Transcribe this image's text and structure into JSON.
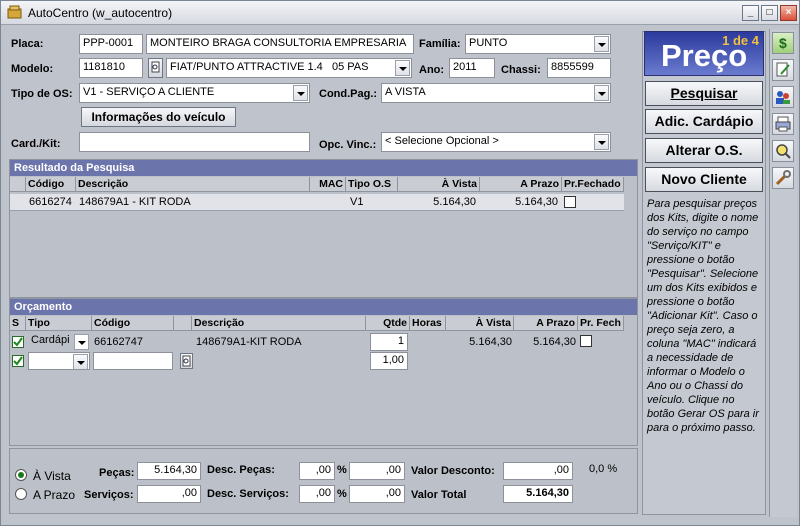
{
  "window": {
    "title": "AutoCentro (w_autocentro)"
  },
  "header": {
    "placa_label": "Placa:",
    "placa_value": "PPP-0001",
    "cliente_nome": "MONTEIRO BRAGA CONSULTORIA EMPRESARIA",
    "familia_label": "Família:",
    "familia_value": "PUNTO",
    "modelo_label": "Modelo:",
    "modelo_code": "1181810",
    "modelo_desc": "FIAT/PUNTO ATTRACTIVE 1.4   05 PAS",
    "ano_label": "Ano:",
    "ano_value": "2011",
    "chassi_label": "Chassi:",
    "chassi_value": "8855599",
    "tipo_os_label": "Tipo de OS:",
    "tipo_os_value": "V1 - SERVIÇO A CLIENTE",
    "cond_pag_label": "Cond.Pag.:",
    "cond_pag_value": "A VISTA",
    "info_veiculo_button": "Informações do veículo",
    "card_kit_label": "Card./Kit:",
    "card_kit_value": "",
    "opc_vinc_label": "Opc. Vinc.:",
    "opc_vinc_value": "< Selecione Opcional >"
  },
  "resultado": {
    "title": "Resultado da Pesquisa",
    "columns": [
      "Código",
      "Descrição",
      "MAC",
      "Tipo O.S",
      "À Vista",
      "A Prazo",
      "Pr.Fechado"
    ],
    "rows": [
      {
        "codigo": "6616274",
        "descricao": "148679A1 - KIT RODA",
        "mac": "",
        "tipo_os": "V1",
        "a_vista": "5.164,30",
        "a_prazo": "5.164,30"
      }
    ]
  },
  "orcamento": {
    "title": "Orçamento",
    "columns": [
      "S",
      "Tipo",
      "Código",
      "Descrição",
      "Qtde",
      "Horas",
      "À Vista",
      "A Prazo",
      "Pr. Fech"
    ],
    "rows": [
      {
        "tipo": "Cardápi",
        "codigo": "66162747",
        "descricao": "148679A1-KIT RODA",
        "qtde": "1",
        "horas": "",
        "a_vista": "5.164,30",
        "a_prazo": "5.164,30"
      },
      {
        "tipo": "",
        "codigo": "",
        "descricao": "",
        "qtde": "1,00",
        "horas": "",
        "a_vista": "",
        "a_prazo": ""
      }
    ]
  },
  "totals": {
    "a_vista_label": "À Vista",
    "a_prazo_label": "A Prazo",
    "pecas_label": "Peças:",
    "pecas_value": "5.164,30",
    "servicos_label": "Serviços:",
    "servicos_value": ",00",
    "desc_pecas_label": "Desc. Peças:",
    "desc_pecas_pct": ",00",
    "desc_pecas_value": ",00",
    "desc_servicos_label": "Desc. Serviços:",
    "desc_servicos_pct": ",00",
    "desc_servicos_value": ",00",
    "pct_symbol": "%",
    "valor_desconto_label": "Valor Desconto:",
    "valor_desconto_value": ",00",
    "valor_desconto_pct": "0,0 %",
    "valor_total_label": "Valor Total",
    "valor_total_value": "5.164,30"
  },
  "sidebar": {
    "page_indicator": "1 de 4",
    "panel_title": "Preço",
    "pesquisar_button": "Pesquisar",
    "adic_cardapio_button": "Adic. Cardápio",
    "alterar_os_button": "Alterar O.S.",
    "novo_cliente_button": "Novo Cliente",
    "help_text": "Para pesquisar preços dos Kits, digite o nome do serviço no campo \"Serviço/KIT\" e pressione o botão \"Pesquisar\". Selecione um dos Kits exibidos e pressione o botão \"Adicionar Kit\". Caso o preço seja zero, a coluna \"MAC\" indicará a necessidade de informar o Modelo o Ano ou o Chassi do veículo. Clique no botão Gerar OS para ir para o próximo passo."
  },
  "colors": {
    "section_header": "#6c74ac",
    "panel_gradient_top": "#3d4aa8",
    "page_indicator": "#f0c040"
  }
}
